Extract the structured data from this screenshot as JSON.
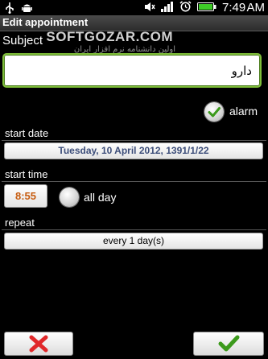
{
  "status_bar": {
    "time": "7:49",
    "meridiem": "AM",
    "icons": [
      "usb-icon",
      "android-debug-icon",
      "silent-mode-icon",
      "signal-icon",
      "alarm-clock-icon",
      "battery-icon"
    ]
  },
  "window": {
    "title": "Edit appointment"
  },
  "watermark": {
    "brand": "SOFTGOZAR.COM",
    "tagline": "اولین دانشنامه نرم افزار ایران"
  },
  "subject": {
    "label": "Subject",
    "value": "دارو"
  },
  "alarm": {
    "label": "alarm",
    "checked": true
  },
  "start_date": {
    "label": "start date",
    "value": "Tuesday, 10 April 2012, 1391/1/22"
  },
  "start_time": {
    "label": "start time",
    "value": "8:55",
    "all_day_label": "all day",
    "all_day": false
  },
  "repeat": {
    "label": "repeat",
    "value": "every 1 day(s)"
  },
  "actions": {
    "cancel_icon": "cross-icon",
    "ok_icon": "checkmark-icon"
  },
  "colors": {
    "background": "#000000",
    "focus_border": "#7fbe3a",
    "date_text": "#3d4e7a",
    "time_text": "#c75c10",
    "cancel": "#e0282a",
    "ok": "#3c9a1c"
  }
}
